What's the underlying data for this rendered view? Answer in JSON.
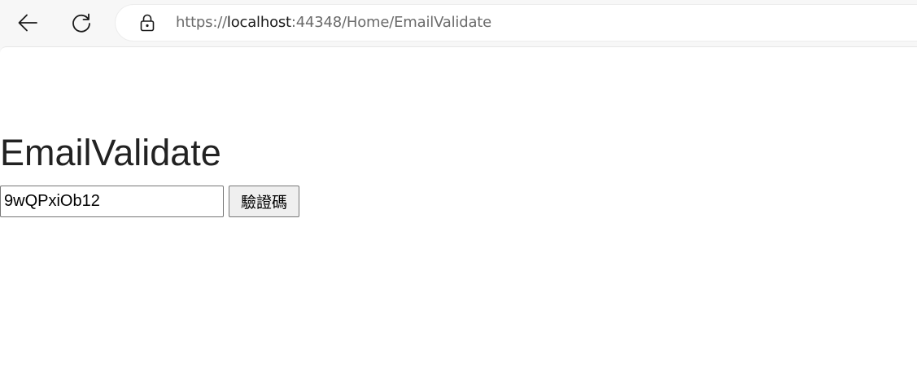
{
  "browser": {
    "back_icon": "arrow-left-icon",
    "reload_icon": "reload-icon",
    "lock_icon": "lock-icon",
    "url": {
      "scheme": "https://",
      "host": "localhost",
      "rest": ":44348/Home/EmailValidate"
    }
  },
  "page": {
    "title": "EmailValidate",
    "code_input_value": "9wQPxiOb12",
    "verify_button_label": "驗證碼"
  }
}
